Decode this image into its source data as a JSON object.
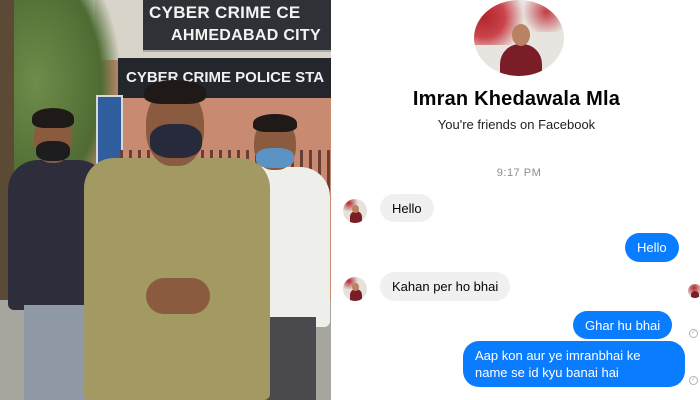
{
  "photo": {
    "sign_top_line1": "CYBER CRIME CE",
    "sign_top_line2": "AHMEDABAD CITY",
    "sign_main": "CYBER CRIME POLICE STA"
  },
  "chat": {
    "contact_name": "Imran Khedawala Mla",
    "friends_note": "You're friends on Facebook",
    "timestamp": "9:17 PM",
    "messages": [
      {
        "direction": "in",
        "text": "Hello"
      },
      {
        "direction": "out",
        "text": "Hello"
      },
      {
        "direction": "in",
        "text": "Kahan per ho bhai"
      },
      {
        "direction": "out",
        "text": "Ghar hu bhai"
      },
      {
        "direction": "out",
        "text": "Aap kon aur ye imranbhai ke name se id kyu banai hai"
      }
    ],
    "colors": {
      "outgoing_bubble": "#0a7cff",
      "incoming_bubble": "#f0f0f0",
      "timestamp": "#8a8d91"
    },
    "icons": {
      "read_receipt": "check-circle-icon"
    }
  }
}
